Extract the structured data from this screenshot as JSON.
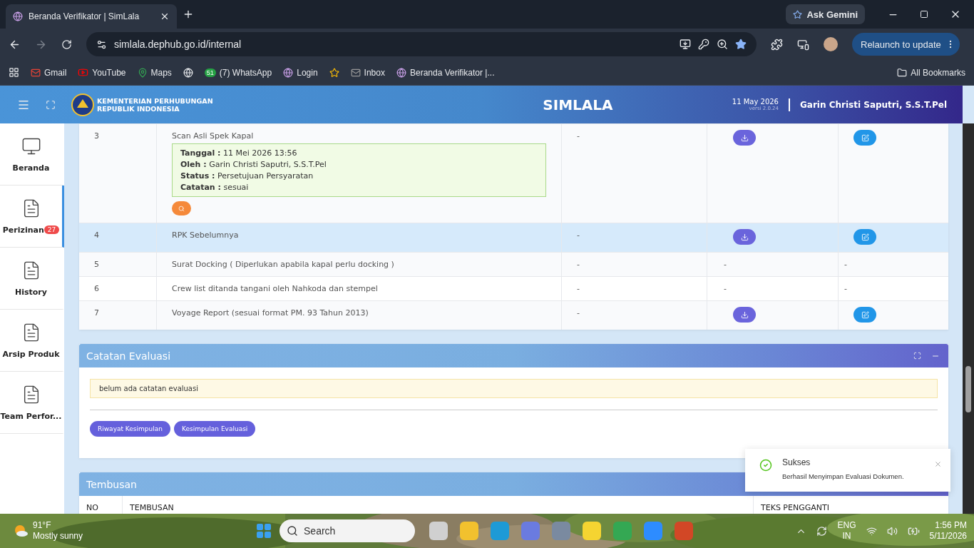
{
  "browser": {
    "tab_title": "Beranda Verifikator | SimLala",
    "url": "simlala.dephub.go.id/internal",
    "ask_gemini": "Ask Gemini",
    "relaunch": "Relaunch to update",
    "bookmarks": [
      {
        "kind": "gmail",
        "label": "Gmail"
      },
      {
        "kind": "youtube",
        "label": "YouTube"
      },
      {
        "kind": "maps",
        "label": "Maps"
      },
      {
        "kind": "globe"
      },
      {
        "kind": "whatsapp",
        "label": "(7) WhatsApp",
        "badge": "51"
      },
      {
        "kind": "site",
        "label": "Login"
      },
      {
        "kind": "photos"
      },
      {
        "kind": "mail",
        "label": "Inbox"
      },
      {
        "kind": "site",
        "label": "Beranda Verifikator |..."
      }
    ],
    "all_bookmarks": "All Bookmarks"
  },
  "header": {
    "org_line_1": "KEMENTERIAN PERHUBUNGAN",
    "org_line_2": "REPUBLIK INDONESIA",
    "title": "SIMLALA",
    "date": "11 May 2026",
    "version": "versi 2.0.24",
    "user": "Garin Christi Saputri, S.S.T.Pel"
  },
  "sidebar": {
    "items": [
      {
        "label": "Beranda",
        "kind": "monitor",
        "selected": false
      },
      {
        "label": "Perizinan",
        "kind": "document",
        "selected": true,
        "badge": "27"
      },
      {
        "label": "History",
        "kind": "document",
        "selected": false
      },
      {
        "label": "Arsip Produk",
        "kind": "document",
        "selected": false
      },
      {
        "label": "Team Perfor...",
        "kind": "document",
        "selected": false
      }
    ]
  },
  "table": {
    "rows": [
      {
        "no": "3",
        "name": "Scan Asli Spek Kapal",
        "selected": false,
        "detail": [
          {
            "label": "Tanggal :",
            "value": "11 Mei 2026 13:56"
          },
          {
            "label": "Oleh :",
            "value": "Garin Christi Saputri, S.S.T.Pel"
          },
          {
            "label": "Status :",
            "value": "Persetujuan Persyaratan"
          },
          {
            "label": "Catatan :",
            "value": "sesuai"
          }
        ],
        "column_3": "-",
        "column_4": {
          "kind": "download"
        },
        "column_5": {
          "kind": "edit"
        }
      },
      {
        "no": "4",
        "name": "RPK Sebelumnya",
        "selected": true,
        "column_3": "-",
        "column_4": {
          "kind": "download"
        },
        "column_5": {
          "kind": "edit"
        }
      },
      {
        "no": "5",
        "name": "Surat Docking ( Diperlukan apabila kapal perlu docking )",
        "selected": false,
        "column_3": "-",
        "column_4": {
          "kind": "text",
          "text": "-"
        },
        "column_5": {
          "kind": "text",
          "text": "-"
        }
      },
      {
        "no": "6",
        "name": "Crew list ditanda tangani oleh Nahkoda dan stempel",
        "selected": false,
        "column_3": "-",
        "column_4": {
          "kind": "text",
          "text": "-"
        },
        "column_5": {
          "kind": "text",
          "text": "-"
        }
      },
      {
        "no": "7",
        "name": "Voyage Report (sesuai format PM. 93 Tahun 2013)",
        "selected": false,
        "column_3": "-",
        "column_4": {
          "kind": "download"
        },
        "column_5": {
          "kind": "edit"
        }
      }
    ]
  },
  "evaluation": {
    "title": "Catatan Evaluasi",
    "note": "belum ada catatan evaluasi",
    "buttons": [
      "Riwayat Kesimpulan",
      "Kesimpulan Evaluasi"
    ]
  },
  "tembusan": {
    "title": "Tembusan",
    "columns": [
      "NO",
      "TEMBUSAN",
      "TEKS PENGGANTI"
    ]
  },
  "toast": {
    "title": "Sukses",
    "message": "Berhasil Menyimpan Evaluasi Dokumen."
  },
  "taskbar": {
    "temperature": "91°F",
    "weather": "Mostly sunny",
    "search": "Search",
    "lang_1": "ENG",
    "lang_2": "IN",
    "time": "1:56 PM",
    "date": "5/11/2026"
  }
}
